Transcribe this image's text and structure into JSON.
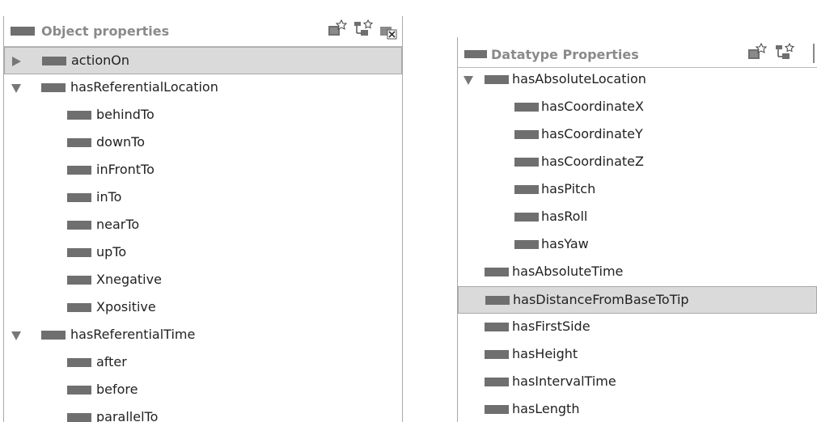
{
  "left_panel": {
    "title": "Object properties",
    "items": [
      {
        "label": "actionOn",
        "depth": 0,
        "toggle": "collapsed",
        "selected": true
      },
      {
        "label": "hasReferentialLocation",
        "depth": 0,
        "toggle": "expanded"
      },
      {
        "label": "behindTo",
        "depth": 1
      },
      {
        "label": "downTo",
        "depth": 1
      },
      {
        "label": "inFrontTo",
        "depth": 1
      },
      {
        "label": "inTo",
        "depth": 1
      },
      {
        "label": "nearTo",
        "depth": 1
      },
      {
        "label": "upTo",
        "depth": 1
      },
      {
        "label": "Xnegative",
        "depth": 1
      },
      {
        "label": "Xpositive",
        "depth": 1
      },
      {
        "label": "hasReferentialTime",
        "depth": 0,
        "toggle": "expanded"
      },
      {
        "label": "after",
        "depth": 1
      },
      {
        "label": "before",
        "depth": 1
      },
      {
        "label": "parallelTo",
        "depth": 1
      }
    ]
  },
  "right_panel": {
    "title": "Datatype Properties",
    "items": [
      {
        "label": "hasAbsoluteLocation",
        "depth": 0,
        "toggle": "expanded"
      },
      {
        "label": "hasCoordinateX",
        "depth": 1
      },
      {
        "label": "hasCoordinateY",
        "depth": 1
      },
      {
        "label": "hasCoordinateZ",
        "depth": 1
      },
      {
        "label": "hasPitch",
        "depth": 1
      },
      {
        "label": "hasRoll",
        "depth": 1
      },
      {
        "label": "hasYaw",
        "depth": 1
      },
      {
        "label": "hasAbsoluteTime",
        "depth": 0
      },
      {
        "label": "hasDistanceFromBaseToTip",
        "depth": 0,
        "selected": true
      },
      {
        "label": "hasFirstSide",
        "depth": 0
      },
      {
        "label": "hasHeight",
        "depth": 0
      },
      {
        "label": "hasIntervalTime",
        "depth": 0
      },
      {
        "label": "hasLength",
        "depth": 0
      }
    ]
  },
  "icons": {
    "toolbar": [
      "add-subproperty-icon",
      "add-sibling-property-icon",
      "delete-property-icon"
    ],
    "node": "property-icon",
    "toggle_expanded": "triangle-down-icon",
    "toggle_collapsed": "triangle-right-icon"
  },
  "colors": {
    "selection": "#dadada",
    "icon": "#6f6f6f",
    "title": "#8a8a8a"
  }
}
